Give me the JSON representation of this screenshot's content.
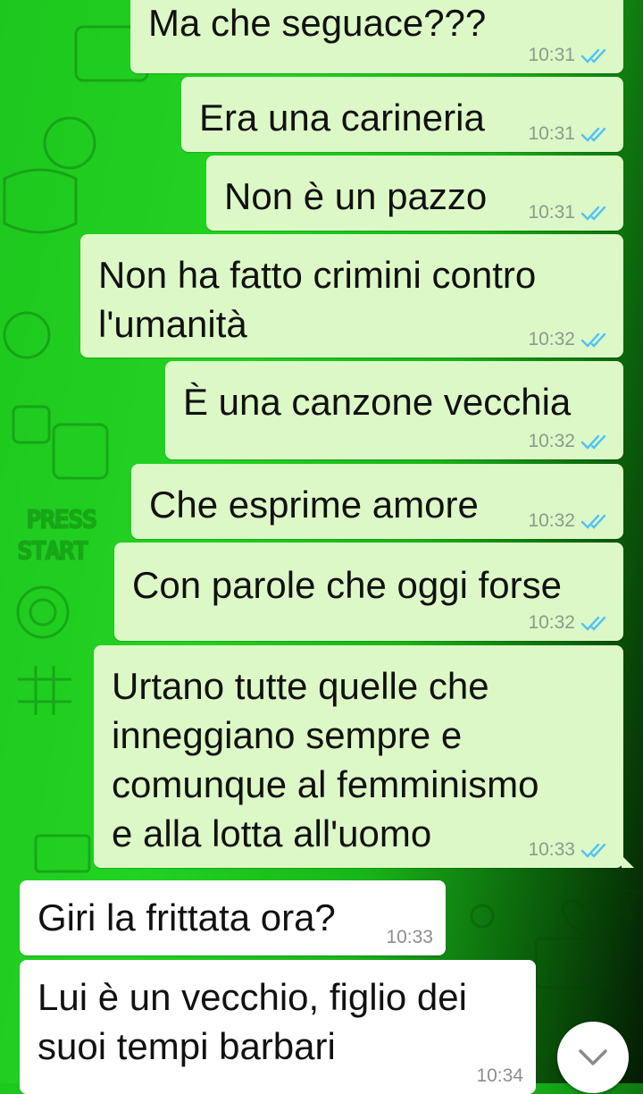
{
  "colors": {
    "outgoing_bubble": "#dcf8c6",
    "incoming_bubble": "#ffffff",
    "read_ticks": "#4fc3f7",
    "background_green": "#22d322"
  },
  "messages": [
    {
      "direction": "out",
      "text": "Ma che seguace???",
      "time": "10:31",
      "status": "read"
    },
    {
      "direction": "out",
      "text": "Era una carineria",
      "time": "10:31",
      "status": "read"
    },
    {
      "direction": "out",
      "text": "Non è un pazzo",
      "time": "10:31",
      "status": "read"
    },
    {
      "direction": "out",
      "text": "Non ha fatto crimini contro\nl'umanità",
      "time": "10:32",
      "status": "read"
    },
    {
      "direction": "out",
      "text": "È una canzone vecchia",
      "time": "10:32",
      "status": "read"
    },
    {
      "direction": "out",
      "text": "Che esprime amore",
      "time": "10:32",
      "status": "read"
    },
    {
      "direction": "out",
      "text": "Con parole che oggi forse",
      "time": "10:32",
      "status": "read"
    },
    {
      "direction": "out",
      "text": "Urtano tutte quelle che\ninneggiano sempre e\ncomunque al femminismo\ne alla lotta all'uomo",
      "time": "10:33",
      "status": "read"
    },
    {
      "direction": "in",
      "text": "Giri la frittata ora?",
      "time": "10:33"
    },
    {
      "direction": "in",
      "text": "Lui è un vecchio, figlio dei\nsuoi tempi barbari",
      "time": "10:34"
    }
  ],
  "scroll_button": {
    "icon": "chevron-down-icon"
  }
}
